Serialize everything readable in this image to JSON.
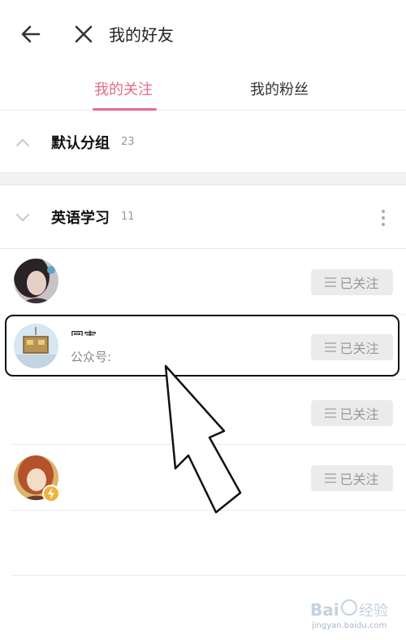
{
  "header": {
    "title": "我的好友"
  },
  "tabs": [
    {
      "label": "我的关注",
      "active": true
    },
    {
      "label": "我的粉丝",
      "active": false
    }
  ],
  "groups": [
    {
      "name": "默认分组",
      "count": "23",
      "expanded": false
    },
    {
      "name": "英语学习",
      "count": "11",
      "expanded": true
    }
  ],
  "contacts": [
    {
      "name": "",
      "sub": "",
      "follow_label": "已关注"
    },
    {
      "name": "圆害",
      "sub": "公众号:",
      "follow_label": "已关注"
    },
    {
      "name": "",
      "sub": "",
      "follow_label": "已关注"
    },
    {
      "name": "",
      "sub": "",
      "follow_label": "已关注"
    }
  ],
  "colors": {
    "accent": "#e56b8b",
    "button_bg": "#ebebeb",
    "button_text": "#999999"
  },
  "icons": {
    "back": "arrow-left-icon",
    "close": "close-icon",
    "chevron_collapsed": "chevron-up-icon",
    "chevron_expanded": "chevron-down-icon",
    "more": "more-vertical-icon",
    "menu": "menu-lines-icon",
    "badge": "lightning-badge-icon"
  },
  "watermark": {
    "brand": "Bai du 经验",
    "url": "jingyan.baidu.com"
  }
}
